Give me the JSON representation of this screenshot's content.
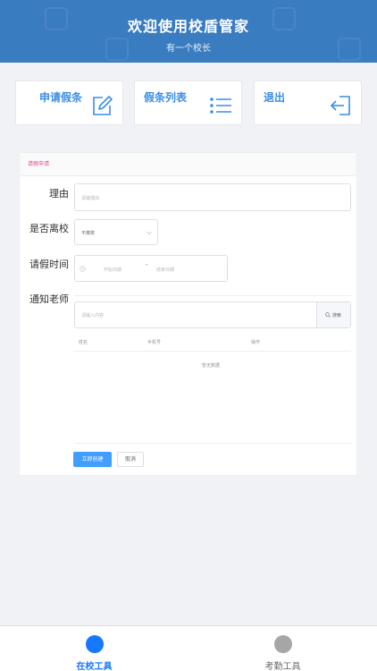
{
  "header": {
    "title": "欢迎使用校盾管家",
    "subtitle": "有一个校长"
  },
  "tiles": [
    {
      "label": "申请假条",
      "icon": "edit-icon"
    },
    {
      "label": "假条列表",
      "icon": "list-icon"
    },
    {
      "label": "退出",
      "icon": "logout-icon"
    }
  ],
  "form": {
    "card_title": "请假申请",
    "reason": {
      "label": "理由",
      "placeholder": "请输理由"
    },
    "leave_school": {
      "label": "是否离校",
      "value": "不离校"
    },
    "leave_time": {
      "label": "请假时间",
      "start_placeholder": "开始日期",
      "separator": "-",
      "end_placeholder": "结束日期"
    },
    "notify_teacher": {
      "label": "通知老师",
      "search_placeholder": "请输入内容",
      "search_button": "搜索",
      "columns": [
        "姓名",
        "手机号",
        "操作"
      ],
      "empty_text": "暂无数据"
    },
    "submit_button": "立即创建",
    "cancel_button": "取消"
  },
  "tabbar": [
    {
      "label": "在校工具",
      "active": true,
      "color": "#1677ff"
    },
    {
      "label": "考勤工具",
      "active": false,
      "color": "#a6a6a6"
    }
  ],
  "colors": {
    "primary": "#3a7cc0",
    "accent": "#409eff",
    "tile_text": "#3a8ee6"
  }
}
